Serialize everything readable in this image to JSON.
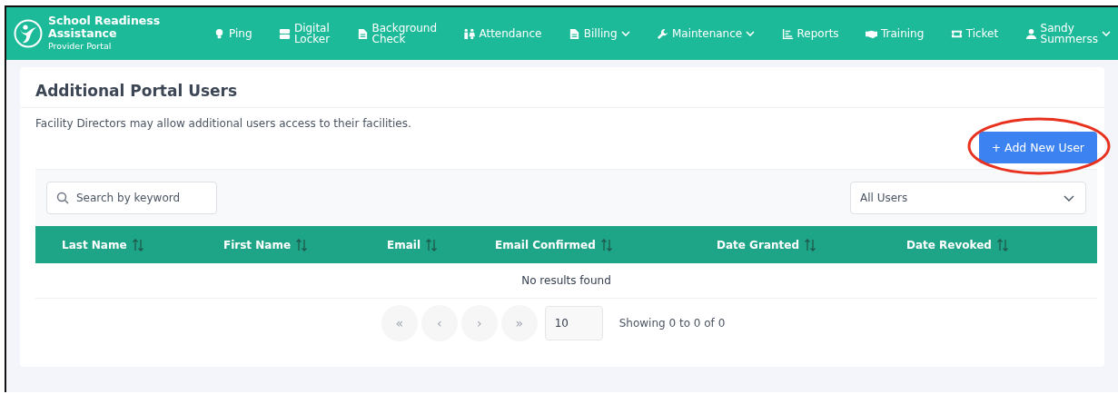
{
  "brand": {
    "title": "School Readiness Assistance",
    "subtitle": "Provider Portal"
  },
  "nav": [
    {
      "label": "Ping",
      "dropdown": false
    },
    {
      "label": "Digital Locker",
      "dropdown": false
    },
    {
      "label": "Background Check",
      "dropdown": false
    },
    {
      "label": "Attendance",
      "dropdown": false
    },
    {
      "label": "Billing",
      "dropdown": true
    },
    {
      "label": "Maintenance",
      "dropdown": true
    },
    {
      "label": "Reports",
      "dropdown": false
    },
    {
      "label": "Training",
      "dropdown": false
    },
    {
      "label": "Ticket",
      "dropdown": false
    },
    {
      "label": "Sandy Summerss",
      "dropdown": true
    }
  ],
  "page": {
    "title": "Additional Portal Users",
    "description": "Facility Directors may allow additional users access to their facilities.",
    "add_button": "+ Add New User"
  },
  "search": {
    "placeholder": "Search by keyword"
  },
  "filter": {
    "value": "All Users"
  },
  "table": {
    "columns": [
      "Last Name",
      "First Name",
      "Email",
      "Email Confirmed",
      "Date Granted",
      "Date Revoked"
    ],
    "empty": "No results found"
  },
  "pagination": {
    "buttons": [
      "«",
      "‹",
      "›",
      "»"
    ],
    "page_size": "10",
    "summary": "Showing 0 to 0 of 0"
  }
}
